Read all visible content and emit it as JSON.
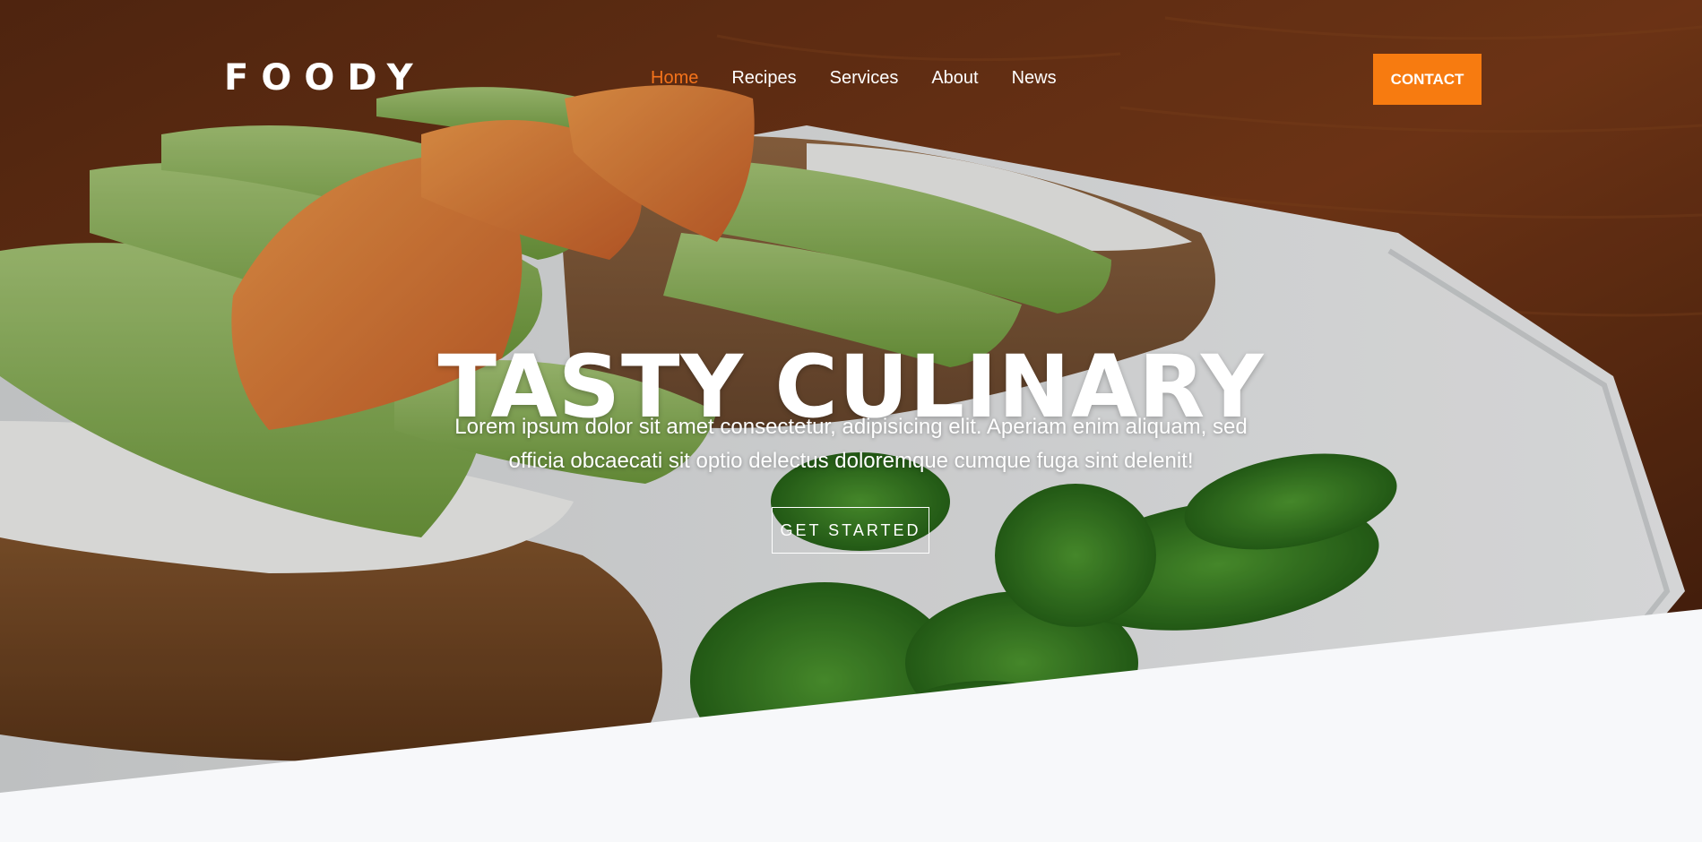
{
  "brand": {
    "logo": "FOODY"
  },
  "nav": {
    "items": [
      {
        "label": "Home",
        "active": true
      },
      {
        "label": "Recipes",
        "active": false
      },
      {
        "label": "Services",
        "active": false
      },
      {
        "label": "About",
        "active": false
      },
      {
        "label": "News",
        "active": false
      }
    ],
    "contact_label": "CONTACT"
  },
  "hero": {
    "title": "TASTY CULINARY",
    "subtitle": "Lorem ipsum dolor sit amet consectetur, adipisicing elit. Aperiam enim aliquam, sed officia obcaecati sit optio delectus doloremque cumque fuga sint delenit!",
    "cta_label": "GET STARTED",
    "image": "avocado-salmon-toast-photo"
  },
  "colors": {
    "accent": "#f77b10",
    "nav_active": "#f4731b",
    "text_light": "#ffffff",
    "page_bg": "#f7f8fa"
  }
}
